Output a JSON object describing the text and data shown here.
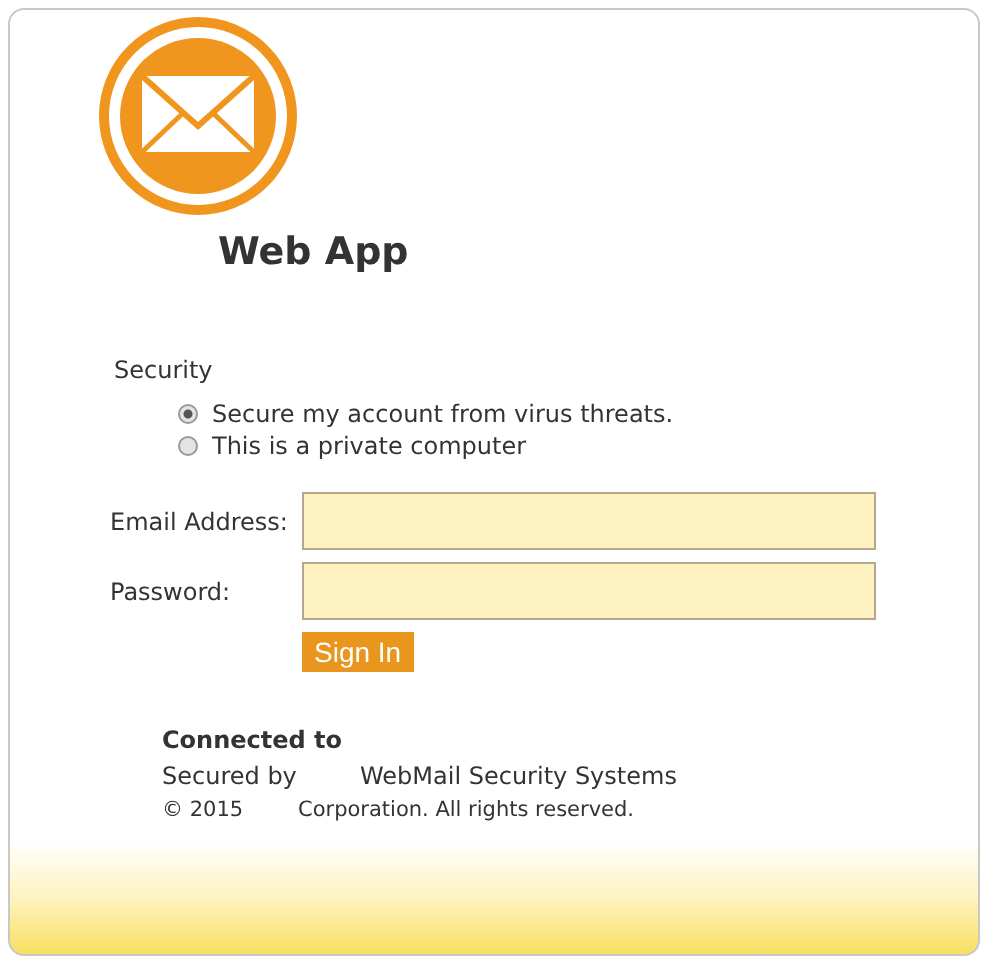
{
  "app_title": "Web App",
  "security": {
    "label": "Security",
    "options": [
      {
        "label": "Secure my account from virus threats.",
        "selected": true
      },
      {
        "label": "This is a private computer",
        "selected": false
      }
    ]
  },
  "fields": [
    {
      "label": "Email Address:"
    },
    {
      "label": "Password:"
    }
  ],
  "sign_in_button": "Sign In",
  "footer": {
    "connected_to": "Connected to",
    "secured_by": "Secured by",
    "secured_by_rest": "WebMail Security Systems",
    "copyright": "© 2015",
    "copyright_rest": "Corporation. All rights reserved."
  }
}
